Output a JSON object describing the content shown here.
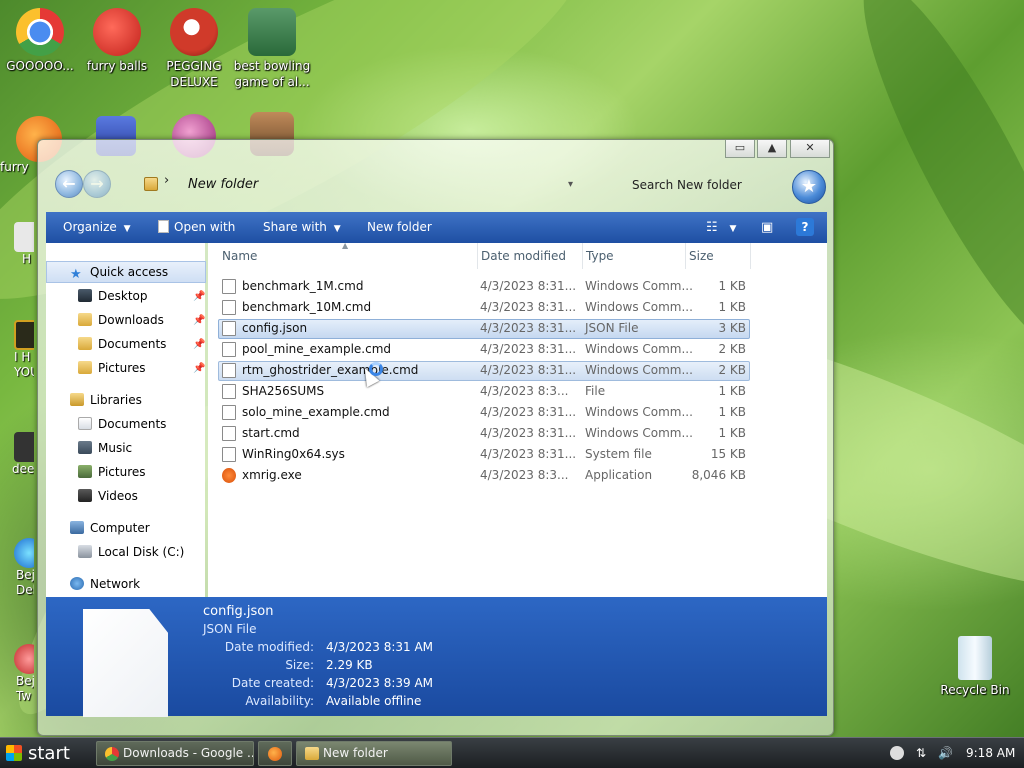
{
  "desktop": {
    "icons": [
      {
        "label": "GOOOOO...",
        "color": "#2a7de1"
      },
      {
        "label": "furry balls",
        "color": "#d93a2a"
      },
      {
        "label": "PEGGING DELUXE",
        "color": "#c0392b"
      },
      {
        "label": "best bowling game of al...",
        "color": "#3b8c4a"
      }
    ],
    "row2_icons": [
      {
        "color": "#f07a1a"
      },
      {
        "color": "#3a5fc8"
      },
      {
        "color": "#b44a9a"
      },
      {
        "color": "#8a6a4a"
      }
    ],
    "left_clipped_labels": [
      "furry",
      "H",
      "I H YOU",
      "deez",
      "Bej Del",
      "Bej Tw"
    ],
    "recycle_bin_label": "Recycle Bin"
  },
  "window": {
    "controls": {
      "minimize": "▭",
      "maximize": "▲",
      "close": "✕"
    },
    "address": {
      "folder": "New folder"
    },
    "search": {
      "placeholder": "Search New folder"
    },
    "commands": {
      "organize": "Organize",
      "open_with": "Open with",
      "share_with": "Share with",
      "new_folder": "New folder"
    },
    "nav": {
      "quick_access": "Quick access",
      "quick_items": [
        "Desktop",
        "Downloads",
        "Documents",
        "Pictures"
      ],
      "libraries": "Libraries",
      "library_items": [
        "Documents",
        "Music",
        "Pictures",
        "Videos"
      ],
      "computer": "Computer",
      "computer_items": [
        "Local Disk (C:)"
      ],
      "network": "Network"
    },
    "columns": {
      "name": "Name",
      "date": "Date modified",
      "type": "Type",
      "size": "Size"
    },
    "files": [
      {
        "name": "benchmark_1M.cmd",
        "date": "4/3/2023 8:31...",
        "type": "Windows Comm...",
        "size": "1 KB"
      },
      {
        "name": "benchmark_10M.cmd",
        "date": "4/3/2023 8:31...",
        "type": "Windows Comm...",
        "size": "1 KB"
      },
      {
        "name": "config.json",
        "date": "4/3/2023 8:31...",
        "type": "JSON File",
        "size": "3 KB"
      },
      {
        "name": "pool_mine_example.cmd",
        "date": "4/3/2023 8:31...",
        "type": "Windows Comm...",
        "size": "2 KB"
      },
      {
        "name": "rtm_ghostrider_example.cmd",
        "date": "4/3/2023 8:31...",
        "type": "Windows Comm...",
        "size": "2 KB"
      },
      {
        "name": "SHA256SUMS",
        "date": "4/3/2023 8:3...",
        "type": "File",
        "size": "1 KB"
      },
      {
        "name": "solo_mine_example.cmd",
        "date": "4/3/2023 8:31...",
        "type": "Windows Comm...",
        "size": "1 KB"
      },
      {
        "name": "start.cmd",
        "date": "4/3/2023 8:31...",
        "type": "Windows Comm...",
        "size": "1 KB"
      },
      {
        "name": "WinRing0x64.sys",
        "date": "4/3/2023 8:31...",
        "type": "System file",
        "size": "15 KB"
      },
      {
        "name": "xmrig.exe",
        "date": "4/3/2023 8:3...",
        "type": "Application",
        "size": "8,046 KB"
      }
    ],
    "details": {
      "name": "config.json",
      "type": "JSON File",
      "rows": [
        {
          "label": "Date modified:",
          "value": "4/3/2023 8:31 AM"
        },
        {
          "label": "Size:",
          "value": "2.29 KB"
        },
        {
          "label": "Date created:",
          "value": "4/3/2023 8:39 AM"
        },
        {
          "label": "Availability:",
          "value": "Available offline"
        }
      ]
    }
  },
  "taskbar": {
    "start": "start",
    "tasks": [
      {
        "label": "Downloads - Google ...",
        "active": false
      },
      {
        "label": "",
        "active": false
      },
      {
        "label": "New folder",
        "active": true
      }
    ],
    "clock": "9:18 AM"
  },
  "colors": {
    "command_bar": "#2a5cb3",
    "details_pane": "#2358b4",
    "selection": "#c5d8f0"
  }
}
